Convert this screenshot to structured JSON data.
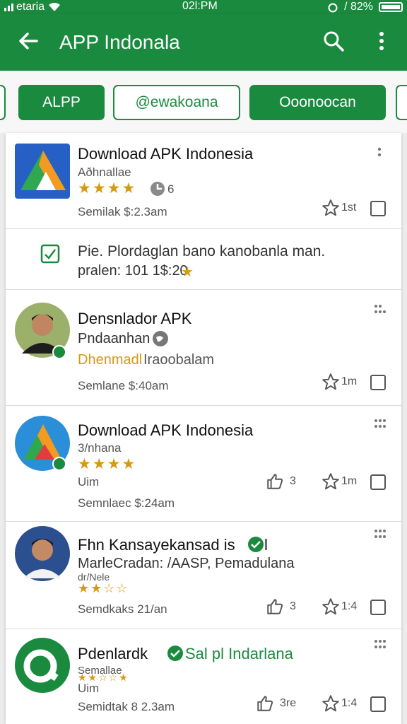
{
  "status_bar": {
    "carrier": "etaria",
    "time": "02l:PM",
    "battery": "/ 82%"
  },
  "app_bar": {
    "title": "APP Indonala"
  },
  "chips": [
    "ALPP",
    "@ewakoana",
    "Ooonoocan"
  ],
  "rows": [
    {
      "title": "Download APK Indonesia",
      "subtitle": "Aðhnallae",
      "rating_count": "6",
      "time": "Semilak $:2.3am",
      "star_count": "1st"
    },
    {
      "notice_text": "Pie. Plordaglan bano kanobanla man.",
      "notice_meta": "pralen: 101 1$:20"
    },
    {
      "title": "Densnlador APK",
      "subtitle": "Pndaanhan",
      "highlight": "Dhenmadl",
      "highlight_rest": "Iraoobalam",
      "time": "Semlane $:40am",
      "star_count": "1m"
    },
    {
      "title": "Download APK Indonesia",
      "subtitle": "3/nhana",
      "line3": "Uim",
      "time": "Semnlaec $:24am",
      "like_count": "3",
      "star_count": "1m"
    },
    {
      "title": "Fhn Kansayekansad is",
      "title_suffix": "l",
      "subtitle": "MarleCradan: /AASP, Pemadulana",
      "line3": "dr/Nele",
      "time": "Semdkaks 21/an",
      "like_count": "3",
      "star_count": "1:4"
    },
    {
      "title": "Pdenlardk",
      "title_green": "Sal pl Indarlana",
      "subtitle": "Semallae",
      "line3": "Uim",
      "time": "Semidtak 8 2.3am",
      "like_count": "3re",
      "star_count": "1:4"
    }
  ],
  "colors": {
    "brand_green": "#1a8a3e",
    "star_gold": "#d59a10"
  }
}
